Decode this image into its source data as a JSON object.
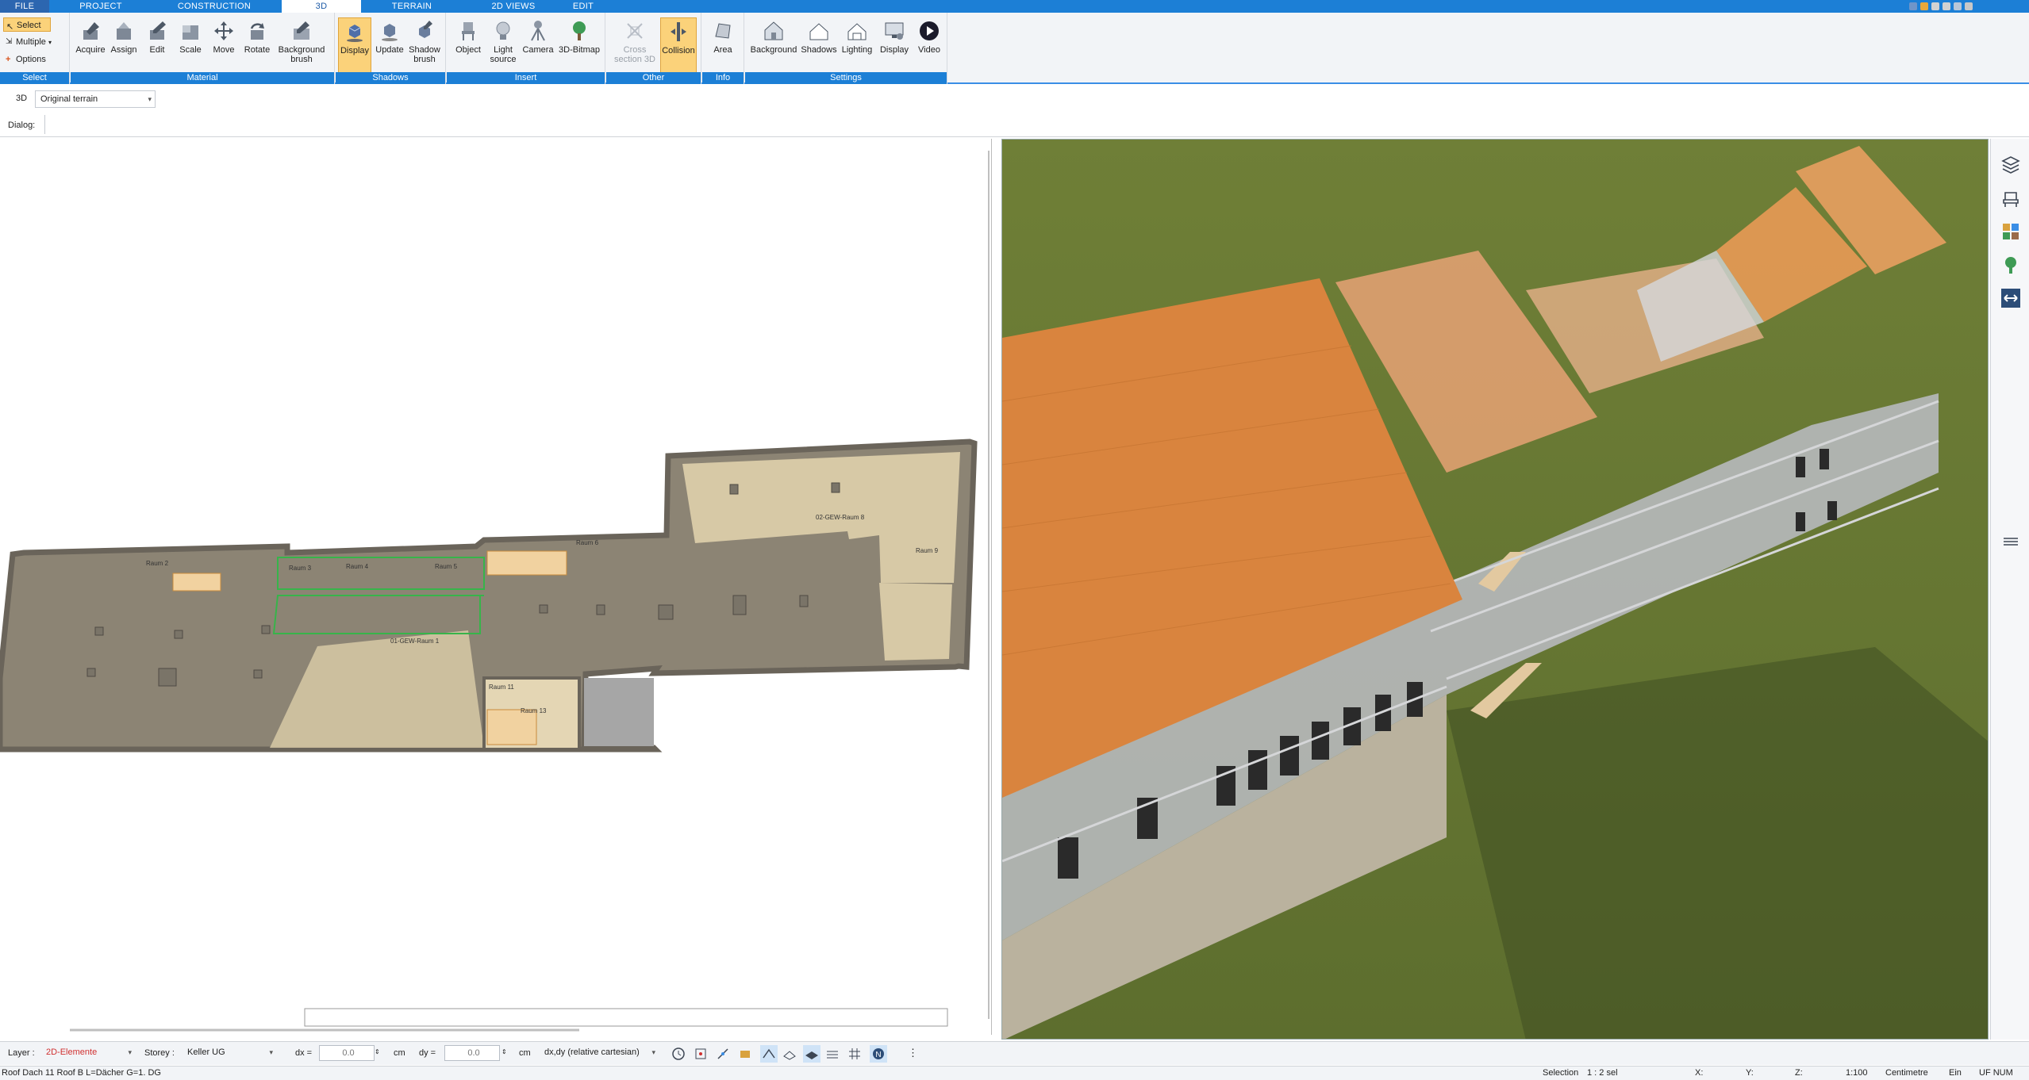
{
  "menu": {
    "tabs": [
      "FILE",
      "PROJECT",
      "CONSTRUCTION",
      "3D",
      "TERRAIN",
      "2D VIEWS",
      "EDIT"
    ],
    "active": "3D"
  },
  "ribbon": {
    "select_group": {
      "label": "Select",
      "select": "Select",
      "multiple": "Multiple",
      "options": "Options"
    },
    "material_group": {
      "label": "Material",
      "buttons": [
        "Acquire",
        "Assign",
        "Edit",
        "Scale",
        "Move",
        "Rotate",
        "Background brush"
      ]
    },
    "shadows_group": {
      "label": "Shadows",
      "buttons": [
        "Display",
        "Update",
        "Shadow brush"
      ]
    },
    "insert_group": {
      "label": "Insert",
      "buttons": [
        "Object",
        "Light source",
        "Camera",
        "3D-Bitmap"
      ]
    },
    "other_group": {
      "label": "Other",
      "buttons": [
        "Cross section 3D",
        "Collision"
      ]
    },
    "info_group": {
      "label": "Info",
      "buttons": [
        "Area"
      ]
    },
    "settings_group": {
      "label": "Settings",
      "buttons": [
        "Background",
        "Shadows",
        "Lighting",
        "Display",
        "Video"
      ]
    }
  },
  "context": {
    "mode": "3D",
    "terrain": "Original terrain",
    "dialog_label": "Dialog:"
  },
  "floorplan": {
    "rooms": [
      "Raum 2",
      "Raum 3",
      "Raum 4",
      "Raum 5",
      "Raum 6",
      "Raum 9",
      "Raum 11",
      "Raum 13",
      "02-GEW-Raum 8",
      "01-GEW-Raum 1"
    ]
  },
  "layerbar": {
    "layer_label": "Layer :",
    "layer_value": "2D-Elemente",
    "storey_label": "Storey :",
    "storey_value": "Keller UG",
    "dx_label": "dx =",
    "dx_value": "0.0",
    "dx_unit": "cm",
    "dy_label": "dy =",
    "dy_value": "0.0",
    "dy_unit": "cm",
    "coord_mode": "dx,dy (relative cartesian)"
  },
  "statusbar": {
    "message": "Roof Dach 11 Roof B L=Dächer G=1. DG",
    "selection_label": "Selection",
    "selection_value": "1 : 2 sel",
    "x_label": "X:",
    "y_label": "Y:",
    "z_label": "Z:",
    "scale": "1:100",
    "unit": "Centimetre",
    "ein": "Ein",
    "flags": "UF NUM"
  },
  "colors": {
    "accent": "#1c7fd6",
    "active_button": "#fbd27a",
    "roof": "#d9843e",
    "grass": "#6c7d3a",
    "floor": "#8c8474"
  }
}
